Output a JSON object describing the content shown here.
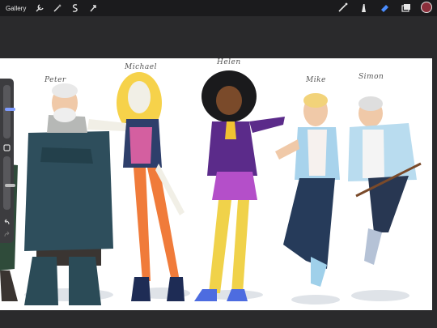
{
  "topbar": {
    "gallery_label": "Gallery",
    "left_tools": [
      "wrench-icon",
      "magic-wand-icon",
      "selection-icon",
      "transform-arrow-icon"
    ],
    "right_tools": [
      "brush-icon",
      "smudge-icon",
      "eraser-icon",
      "layers-icon"
    ],
    "active_tool": "eraser-icon",
    "current_color": "#8b2e3a"
  },
  "sidebar": {
    "brush_size": 0.55,
    "opacity": 0.45,
    "modify_button": "square-icon",
    "undo": "undo-icon",
    "redo": "redo-icon"
  },
  "artwork": {
    "characters": [
      {
        "name": "Peter"
      },
      {
        "name": "Michael"
      },
      {
        "name": "Helen"
      },
      {
        "name": "Mike"
      },
      {
        "name": "Simon"
      }
    ]
  }
}
